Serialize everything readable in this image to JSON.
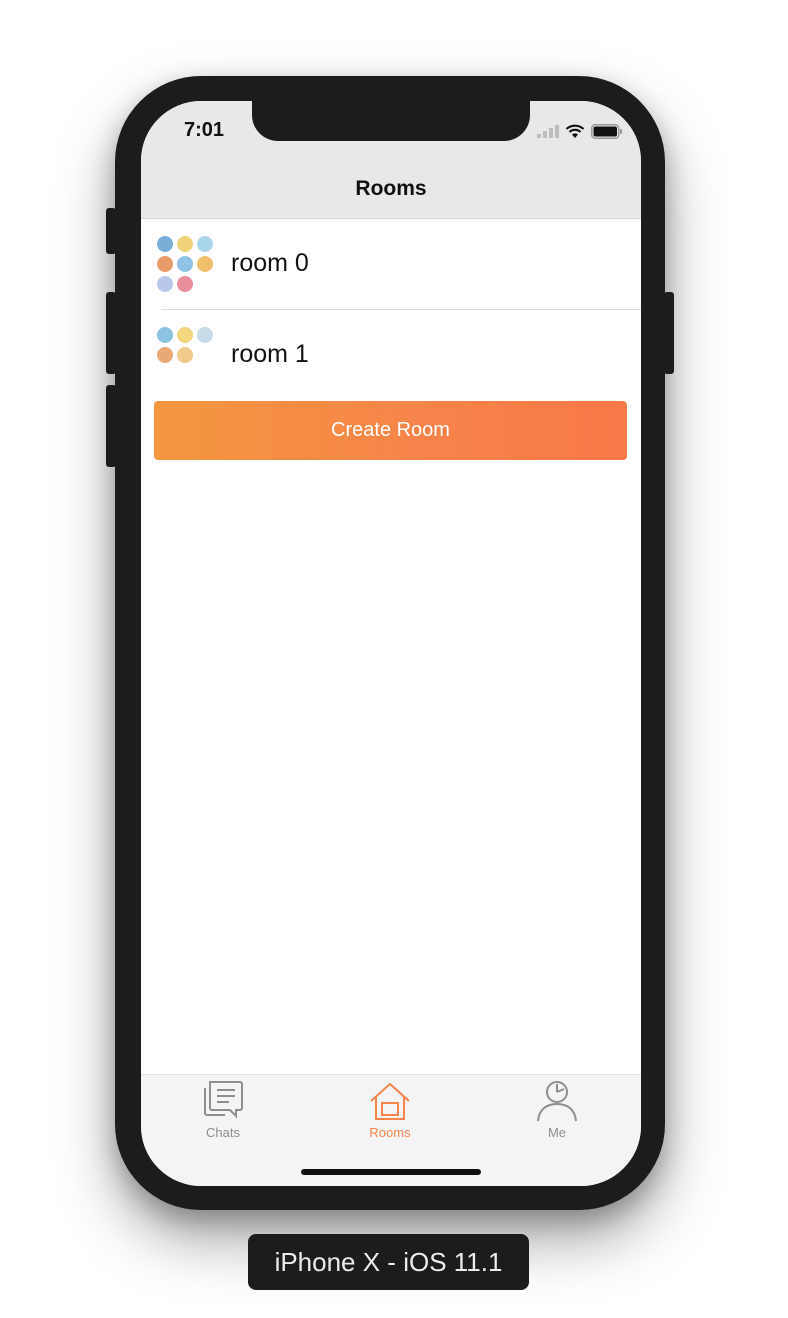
{
  "status_bar": {
    "time": "7:01",
    "icons": [
      "signal-icon",
      "wifi-icon",
      "battery-icon"
    ]
  },
  "navbar": {
    "title": "Rooms"
  },
  "rooms": [
    {
      "name": "room 0",
      "avatar_colors": [
        "#7aaed9",
        "#f0d27a",
        "#a9d6ec",
        "#e99a6b",
        "#8fc3e6",
        "#f1c06c",
        "#b9c7ec",
        "#e98f9c"
      ]
    },
    {
      "name": "room 1",
      "avatar_colors": [
        "#8cc3e3",
        "#f3d680",
        "#c7dbe9",
        "#e9a874",
        "#f1cb8c"
      ]
    }
  ],
  "create_button": {
    "label": "Create Room"
  },
  "tabs": [
    {
      "label": "Chats",
      "icon": "chat-icon",
      "active": false
    },
    {
      "label": "Rooms",
      "icon": "home-icon",
      "active": true
    },
    {
      "label": "Me",
      "icon": "person-icon",
      "active": false
    }
  ],
  "colors": {
    "accent": "#f7844a",
    "inactive_tab": "#8e8e8e",
    "navbar_bg": "#e9e7e8"
  },
  "device_label": "iPhone X - iOS 11.1"
}
